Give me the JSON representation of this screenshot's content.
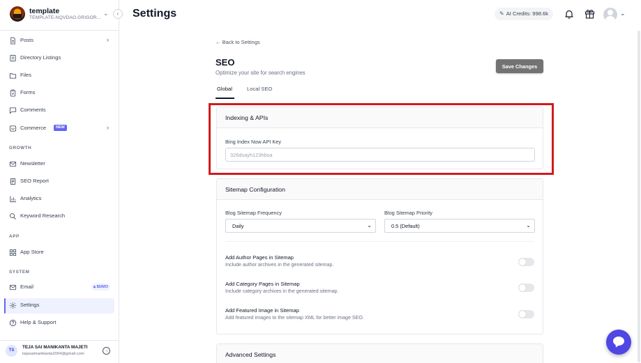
{
  "app": {
    "workspace_name": "template",
    "workspace_id": "TEMPLATE-NQVDAO.GRIGOR...",
    "page_title": "Settings",
    "ai_credits_label": "AI Credits: 998.6k"
  },
  "sidebar": {
    "items": [
      {
        "label": "Posts",
        "icon": "document-icon"
      },
      {
        "label": "Directory Listings",
        "icon": "list-icon"
      },
      {
        "label": "Files",
        "icon": "folder-icon"
      },
      {
        "label": "Forms",
        "icon": "clipboard-icon"
      },
      {
        "label": "Comments",
        "icon": "chat-bubble-icon"
      },
      {
        "label": "Commerce",
        "icon": "cart-icon",
        "badge": "NEW"
      }
    ],
    "growth_label": "GROWTH",
    "growth": [
      {
        "label": "Newsletter",
        "icon": "mail-icon"
      },
      {
        "label": "SEO Report",
        "icon": "report-icon"
      },
      {
        "label": "Analytics",
        "icon": "bar-chart-icon"
      },
      {
        "label": "Keyword Research",
        "icon": "search-icon"
      }
    ],
    "app_label": "APP",
    "app_items": [
      {
        "label": "App Store",
        "icon": "grid-icon"
      }
    ],
    "system_label": "SYSTEM",
    "system": [
      {
        "label": "Email",
        "icon": "mail-icon",
        "badge": "$5/MO"
      },
      {
        "label": "Settings",
        "icon": "gear-icon",
        "active": true
      },
      {
        "label": "Help & Support",
        "icon": "help-icon"
      }
    ]
  },
  "user": {
    "initials": "TS",
    "name": "TEJA SAI MANIKANTA MAJETI",
    "email": "tejasaimanikanta2004@gmail.com"
  },
  "seo": {
    "back_link": "← Back to Settings",
    "title": "SEO",
    "subtitle": "Optimize your site for search engines",
    "save_label": "Save Changes",
    "tabs": [
      {
        "label": "Global",
        "active": true
      },
      {
        "label": "Local SEO",
        "active": false
      }
    ],
    "indexing": {
      "title": "Indexing & APIs",
      "bing_label": "Bing Index Now API Key",
      "bing_value": "326dsayh123hbsa"
    },
    "sitemap": {
      "title": "Sitemap Configuration",
      "frequency_label": "Blog Sitemap Frequency",
      "frequency_value": "Daily",
      "priority_label": "Blog Sitemap Priority",
      "priority_value": "0.5 (Default)",
      "toggles": [
        {
          "title": "Add Author Pages in Sitemap",
          "desc": "Include author archives in the generated sitemap.",
          "enabled": false
        },
        {
          "title": "Add Category Pages in Sitemap",
          "desc": "Include category archives in the generated sitemap.",
          "enabled": false
        },
        {
          "title": "Add Featured Image in Sitemap",
          "desc": "Add featured images to the sitemap XML for better image SEO.",
          "enabled": false
        }
      ]
    },
    "advanced": {
      "title": "Advanced Settings"
    }
  },
  "colors": {
    "accent": "#6366f1",
    "highlight": "#d11b1b",
    "chat": "#4f46e5"
  }
}
